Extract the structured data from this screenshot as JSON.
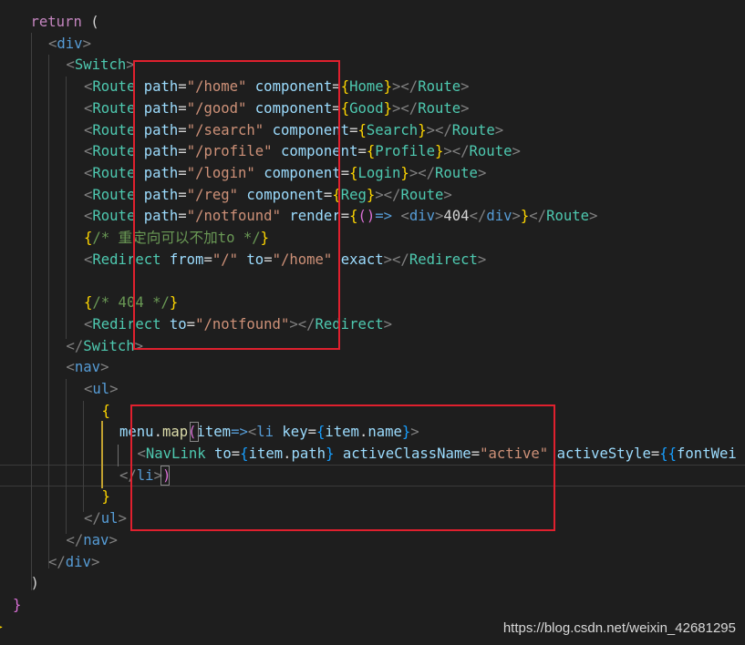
{
  "watermark": "https://blog.csdn.net/weixin_42681295",
  "lines": [
    {
      "name": "line-return",
      "indent": 1,
      "tokens": [
        {
          "t": "return",
          "c": "kw"
        },
        {
          "t": " (",
          "c": "plain"
        }
      ]
    },
    {
      "name": "line-div-open",
      "indent": 2,
      "tokens": [
        {
          "t": "<",
          "c": "ptag"
        },
        {
          "t": "div",
          "c": "tag"
        },
        {
          "t": ">",
          "c": "ptag"
        }
      ]
    },
    {
      "name": "line-switch-open",
      "indent": 3,
      "tokens": [
        {
          "t": "<",
          "c": "ptag"
        },
        {
          "t": "Switch",
          "c": "comp"
        },
        {
          "t": ">",
          "c": "ptag"
        }
      ]
    },
    {
      "name": "line-route-home",
      "indent": 4,
      "tokens": [
        {
          "t": "<",
          "c": "ptag"
        },
        {
          "t": "Route",
          "c": "comp"
        },
        {
          "t": " ",
          "c": "plain"
        },
        {
          "t": "path",
          "c": "attr"
        },
        {
          "t": "=",
          "c": "op"
        },
        {
          "t": "\"/home\"",
          "c": "str"
        },
        {
          "t": " ",
          "c": "plain"
        },
        {
          "t": "component",
          "c": "attr"
        },
        {
          "t": "=",
          "c": "op"
        },
        {
          "t": "{",
          "c": "brace"
        },
        {
          "t": "Home",
          "c": "comp"
        },
        {
          "t": "}",
          "c": "brace"
        },
        {
          "t": "></",
          "c": "ptag"
        },
        {
          "t": "Route",
          "c": "comp"
        },
        {
          "t": ">",
          "c": "ptag"
        }
      ]
    },
    {
      "name": "line-route-good",
      "indent": 4,
      "tokens": [
        {
          "t": "<",
          "c": "ptag"
        },
        {
          "t": "Route",
          "c": "comp"
        },
        {
          "t": " ",
          "c": "plain"
        },
        {
          "t": "path",
          "c": "attr"
        },
        {
          "t": "=",
          "c": "op"
        },
        {
          "t": "\"/good\"",
          "c": "str"
        },
        {
          "t": " ",
          "c": "plain"
        },
        {
          "t": "component",
          "c": "attr"
        },
        {
          "t": "=",
          "c": "op"
        },
        {
          "t": "{",
          "c": "brace"
        },
        {
          "t": "Good",
          "c": "comp"
        },
        {
          "t": "}",
          "c": "brace"
        },
        {
          "t": "></",
          "c": "ptag"
        },
        {
          "t": "Route",
          "c": "comp"
        },
        {
          "t": ">",
          "c": "ptag"
        }
      ]
    },
    {
      "name": "line-route-search",
      "indent": 4,
      "tokens": [
        {
          "t": "<",
          "c": "ptag"
        },
        {
          "t": "Route",
          "c": "comp"
        },
        {
          "t": " ",
          "c": "plain"
        },
        {
          "t": "path",
          "c": "attr"
        },
        {
          "t": "=",
          "c": "op"
        },
        {
          "t": "\"/search\"",
          "c": "str"
        },
        {
          "t": " ",
          "c": "plain"
        },
        {
          "t": "component",
          "c": "attr"
        },
        {
          "t": "=",
          "c": "op"
        },
        {
          "t": "{",
          "c": "brace"
        },
        {
          "t": "Search",
          "c": "comp"
        },
        {
          "t": "}",
          "c": "brace"
        },
        {
          "t": "></",
          "c": "ptag"
        },
        {
          "t": "Route",
          "c": "comp"
        },
        {
          "t": ">",
          "c": "ptag"
        }
      ]
    },
    {
      "name": "line-route-profile",
      "indent": 4,
      "tokens": [
        {
          "t": "<",
          "c": "ptag"
        },
        {
          "t": "Route",
          "c": "comp"
        },
        {
          "t": " ",
          "c": "plain"
        },
        {
          "t": "path",
          "c": "attr"
        },
        {
          "t": "=",
          "c": "op"
        },
        {
          "t": "\"/profile\"",
          "c": "str"
        },
        {
          "t": " ",
          "c": "plain"
        },
        {
          "t": "component",
          "c": "attr"
        },
        {
          "t": "=",
          "c": "op"
        },
        {
          "t": "{",
          "c": "brace"
        },
        {
          "t": "Profile",
          "c": "comp"
        },
        {
          "t": "}",
          "c": "brace"
        },
        {
          "t": "></",
          "c": "ptag"
        },
        {
          "t": "Route",
          "c": "comp"
        },
        {
          "t": ">",
          "c": "ptag"
        }
      ]
    },
    {
      "name": "line-route-login",
      "indent": 4,
      "tokens": [
        {
          "t": "<",
          "c": "ptag"
        },
        {
          "t": "Route",
          "c": "comp"
        },
        {
          "t": " ",
          "c": "plain"
        },
        {
          "t": "path",
          "c": "attr"
        },
        {
          "t": "=",
          "c": "op"
        },
        {
          "t": "\"/login\"",
          "c": "str"
        },
        {
          "t": " ",
          "c": "plain"
        },
        {
          "t": "component",
          "c": "attr"
        },
        {
          "t": "=",
          "c": "op"
        },
        {
          "t": "{",
          "c": "brace"
        },
        {
          "t": "Login",
          "c": "comp"
        },
        {
          "t": "}",
          "c": "brace"
        },
        {
          "t": "></",
          "c": "ptag"
        },
        {
          "t": "Route",
          "c": "comp"
        },
        {
          "t": ">",
          "c": "ptag"
        }
      ]
    },
    {
      "name": "line-route-reg",
      "indent": 4,
      "tokens": [
        {
          "t": "<",
          "c": "ptag"
        },
        {
          "t": "Route",
          "c": "comp"
        },
        {
          "t": " ",
          "c": "plain"
        },
        {
          "t": "path",
          "c": "attr"
        },
        {
          "t": "=",
          "c": "op"
        },
        {
          "t": "\"/reg\"",
          "c": "str"
        },
        {
          "t": " ",
          "c": "plain"
        },
        {
          "t": "component",
          "c": "attr"
        },
        {
          "t": "=",
          "c": "op"
        },
        {
          "t": "{",
          "c": "brace"
        },
        {
          "t": "Reg",
          "c": "comp"
        },
        {
          "t": "}",
          "c": "brace"
        },
        {
          "t": "></",
          "c": "ptag"
        },
        {
          "t": "Route",
          "c": "comp"
        },
        {
          "t": ">",
          "c": "ptag"
        }
      ]
    },
    {
      "name": "line-route-notfound",
      "indent": 4,
      "tokens": [
        {
          "t": "<",
          "c": "ptag"
        },
        {
          "t": "Route",
          "c": "comp"
        },
        {
          "t": " ",
          "c": "plain"
        },
        {
          "t": "path",
          "c": "attr"
        },
        {
          "t": "=",
          "c": "op"
        },
        {
          "t": "\"/notfound\"",
          "c": "str"
        },
        {
          "t": " ",
          "c": "plain"
        },
        {
          "t": "render",
          "c": "attr"
        },
        {
          "t": "=",
          "c": "op"
        },
        {
          "t": "{",
          "c": "brace"
        },
        {
          "t": "()",
          "c": "brace2"
        },
        {
          "t": "=>",
          "c": "arrow"
        },
        {
          "t": " ",
          "c": "plain"
        },
        {
          "t": "<",
          "c": "ptag"
        },
        {
          "t": "div",
          "c": "tag"
        },
        {
          "t": ">",
          "c": "ptag"
        },
        {
          "t": "404",
          "c": "plain"
        },
        {
          "t": "</",
          "c": "ptag"
        },
        {
          "t": "div",
          "c": "tag"
        },
        {
          "t": ">",
          "c": "ptag"
        },
        {
          "t": "}",
          "c": "brace"
        },
        {
          "t": "</",
          "c": "ptag"
        },
        {
          "t": "Route",
          "c": "comp"
        },
        {
          "t": ">",
          "c": "ptag"
        }
      ]
    },
    {
      "name": "line-comment-redirect",
      "indent": 4,
      "tokens": [
        {
          "t": "{",
          "c": "brace"
        },
        {
          "t": "/* 重定向可以不加to */",
          "c": "comment"
        },
        {
          "t": "}",
          "c": "brace"
        }
      ]
    },
    {
      "name": "line-redirect-home",
      "indent": 4,
      "tokens": [
        {
          "t": "<",
          "c": "ptag"
        },
        {
          "t": "Redirect",
          "c": "comp"
        },
        {
          "t": " ",
          "c": "plain"
        },
        {
          "t": "from",
          "c": "attr"
        },
        {
          "t": "=",
          "c": "op"
        },
        {
          "t": "\"/\"",
          "c": "str"
        },
        {
          "t": " ",
          "c": "plain"
        },
        {
          "t": "to",
          "c": "attr"
        },
        {
          "t": "=",
          "c": "op"
        },
        {
          "t": "\"/home\"",
          "c": "str"
        },
        {
          "t": " ",
          "c": "plain"
        },
        {
          "t": "exact",
          "c": "attr"
        },
        {
          "t": "></",
          "c": "ptag"
        },
        {
          "t": "Redirect",
          "c": "comp"
        },
        {
          "t": ">",
          "c": "ptag"
        }
      ]
    },
    {
      "name": "line-blank",
      "indent": 4,
      "tokens": []
    },
    {
      "name": "line-comment-404",
      "indent": 4,
      "tokens": [
        {
          "t": "{",
          "c": "brace"
        },
        {
          "t": "/* 404 */",
          "c": "comment"
        },
        {
          "t": "}",
          "c": "brace"
        }
      ]
    },
    {
      "name": "line-redirect-notfound",
      "indent": 4,
      "tokens": [
        {
          "t": "<",
          "c": "ptag"
        },
        {
          "t": "Redirect",
          "c": "comp"
        },
        {
          "t": " ",
          "c": "plain"
        },
        {
          "t": "to",
          "c": "attr"
        },
        {
          "t": "=",
          "c": "op"
        },
        {
          "t": "\"/notfound\"",
          "c": "str"
        },
        {
          "t": "></",
          "c": "ptag"
        },
        {
          "t": "Redirect",
          "c": "comp"
        },
        {
          "t": ">",
          "c": "ptag"
        }
      ]
    },
    {
      "name": "line-switch-close",
      "indent": 3,
      "tokens": [
        {
          "t": "</",
          "c": "ptag"
        },
        {
          "t": "Switch",
          "c": "comp"
        },
        {
          "t": ">",
          "c": "ptag"
        }
      ]
    },
    {
      "name": "line-nav-open",
      "indent": 3,
      "tokens": [
        {
          "t": "<",
          "c": "ptag"
        },
        {
          "t": "nav",
          "c": "tag"
        },
        {
          "t": ">",
          "c": "ptag"
        }
      ]
    },
    {
      "name": "line-ul-open",
      "indent": 4,
      "tokens": [
        {
          "t": "<",
          "c": "ptag"
        },
        {
          "t": "ul",
          "c": "tag"
        },
        {
          "t": ">",
          "c": "ptag"
        }
      ]
    },
    {
      "name": "line-brace-open",
      "indent": 5,
      "tokens": [
        {
          "t": "{",
          "c": "brace"
        }
      ]
    },
    {
      "name": "line-menu-map",
      "indent": 6,
      "tokens": [
        {
          "t": "menu",
          "c": "var"
        },
        {
          "t": ".",
          "c": "plain"
        },
        {
          "t": "map",
          "c": "fn"
        },
        {
          "t": "(",
          "c": "brace2"
        },
        {
          "t": "item",
          "c": "var"
        },
        {
          "t": "=>",
          "c": "arrow"
        },
        {
          "t": "<",
          "c": "ptag"
        },
        {
          "t": "li",
          "c": "tag"
        },
        {
          "t": " ",
          "c": "plain"
        },
        {
          "t": "key",
          "c": "attr"
        },
        {
          "t": "=",
          "c": "op"
        },
        {
          "t": "{",
          "c": "brace3"
        },
        {
          "t": "item",
          "c": "var"
        },
        {
          "t": ".",
          "c": "plain"
        },
        {
          "t": "name",
          "c": "var"
        },
        {
          "t": "}",
          "c": "brace3"
        },
        {
          "t": ">",
          "c": "ptag"
        }
      ]
    },
    {
      "name": "line-navlink",
      "indent": 7,
      "tokens": [
        {
          "t": "<",
          "c": "ptag"
        },
        {
          "t": "NavLink",
          "c": "comp"
        },
        {
          "t": " ",
          "c": "plain"
        },
        {
          "t": "to",
          "c": "attr"
        },
        {
          "t": "=",
          "c": "op"
        },
        {
          "t": "{",
          "c": "brace3"
        },
        {
          "t": "item",
          "c": "var"
        },
        {
          "t": ".",
          "c": "plain"
        },
        {
          "t": "path",
          "c": "var"
        },
        {
          "t": "}",
          "c": "brace3"
        },
        {
          "t": " ",
          "c": "plain"
        },
        {
          "t": "activeClassName",
          "c": "attr"
        },
        {
          "t": "=",
          "c": "op"
        },
        {
          "t": "\"active\"",
          "c": "str"
        },
        {
          "t": " ",
          "c": "plain"
        },
        {
          "t": "activeStyle",
          "c": "attr"
        },
        {
          "t": "=",
          "c": "op"
        },
        {
          "t": "{{",
          "c": "brace3"
        },
        {
          "t": "fontWei",
          "c": "var"
        }
      ]
    },
    {
      "name": "line-li-close",
      "indent": 6,
      "tokens": [
        {
          "t": "</",
          "c": "ptag"
        },
        {
          "t": "li",
          "c": "tag"
        },
        {
          "t": ">",
          "c": "ptag"
        },
        {
          "t": ")",
          "c": "brace2"
        }
      ]
    },
    {
      "name": "line-brace-close",
      "indent": 5,
      "tokens": [
        {
          "t": "}",
          "c": "brace"
        }
      ]
    },
    {
      "name": "line-ul-close",
      "indent": 4,
      "tokens": [
        {
          "t": "</",
          "c": "ptag"
        },
        {
          "t": "ul",
          "c": "tag"
        },
        {
          "t": ">",
          "c": "ptag"
        }
      ]
    },
    {
      "name": "line-nav-close",
      "indent": 3,
      "tokens": [
        {
          "t": "</",
          "c": "ptag"
        },
        {
          "t": "nav",
          "c": "tag"
        },
        {
          "t": ">",
          "c": "ptag"
        }
      ]
    },
    {
      "name": "line-div-close",
      "indent": 2,
      "tokens": [
        {
          "t": "</",
          "c": "ptag"
        },
        {
          "t": "div",
          "c": "tag"
        },
        {
          "t": ">",
          "c": "ptag"
        }
      ]
    },
    {
      "name": "line-paren-close",
      "indent": 1,
      "tokens": [
        {
          "t": ")",
          "c": "plain"
        }
      ]
    },
    {
      "name": "line-fn-brace-close",
      "indent": 0,
      "tokens": [
        {
          "t": "}",
          "c": "brace2"
        }
      ]
    },
    {
      "name": "line-outer-brace-close",
      "indent": -1,
      "tokens": [
        {
          "t": "}",
          "c": "brace"
        }
      ]
    }
  ]
}
